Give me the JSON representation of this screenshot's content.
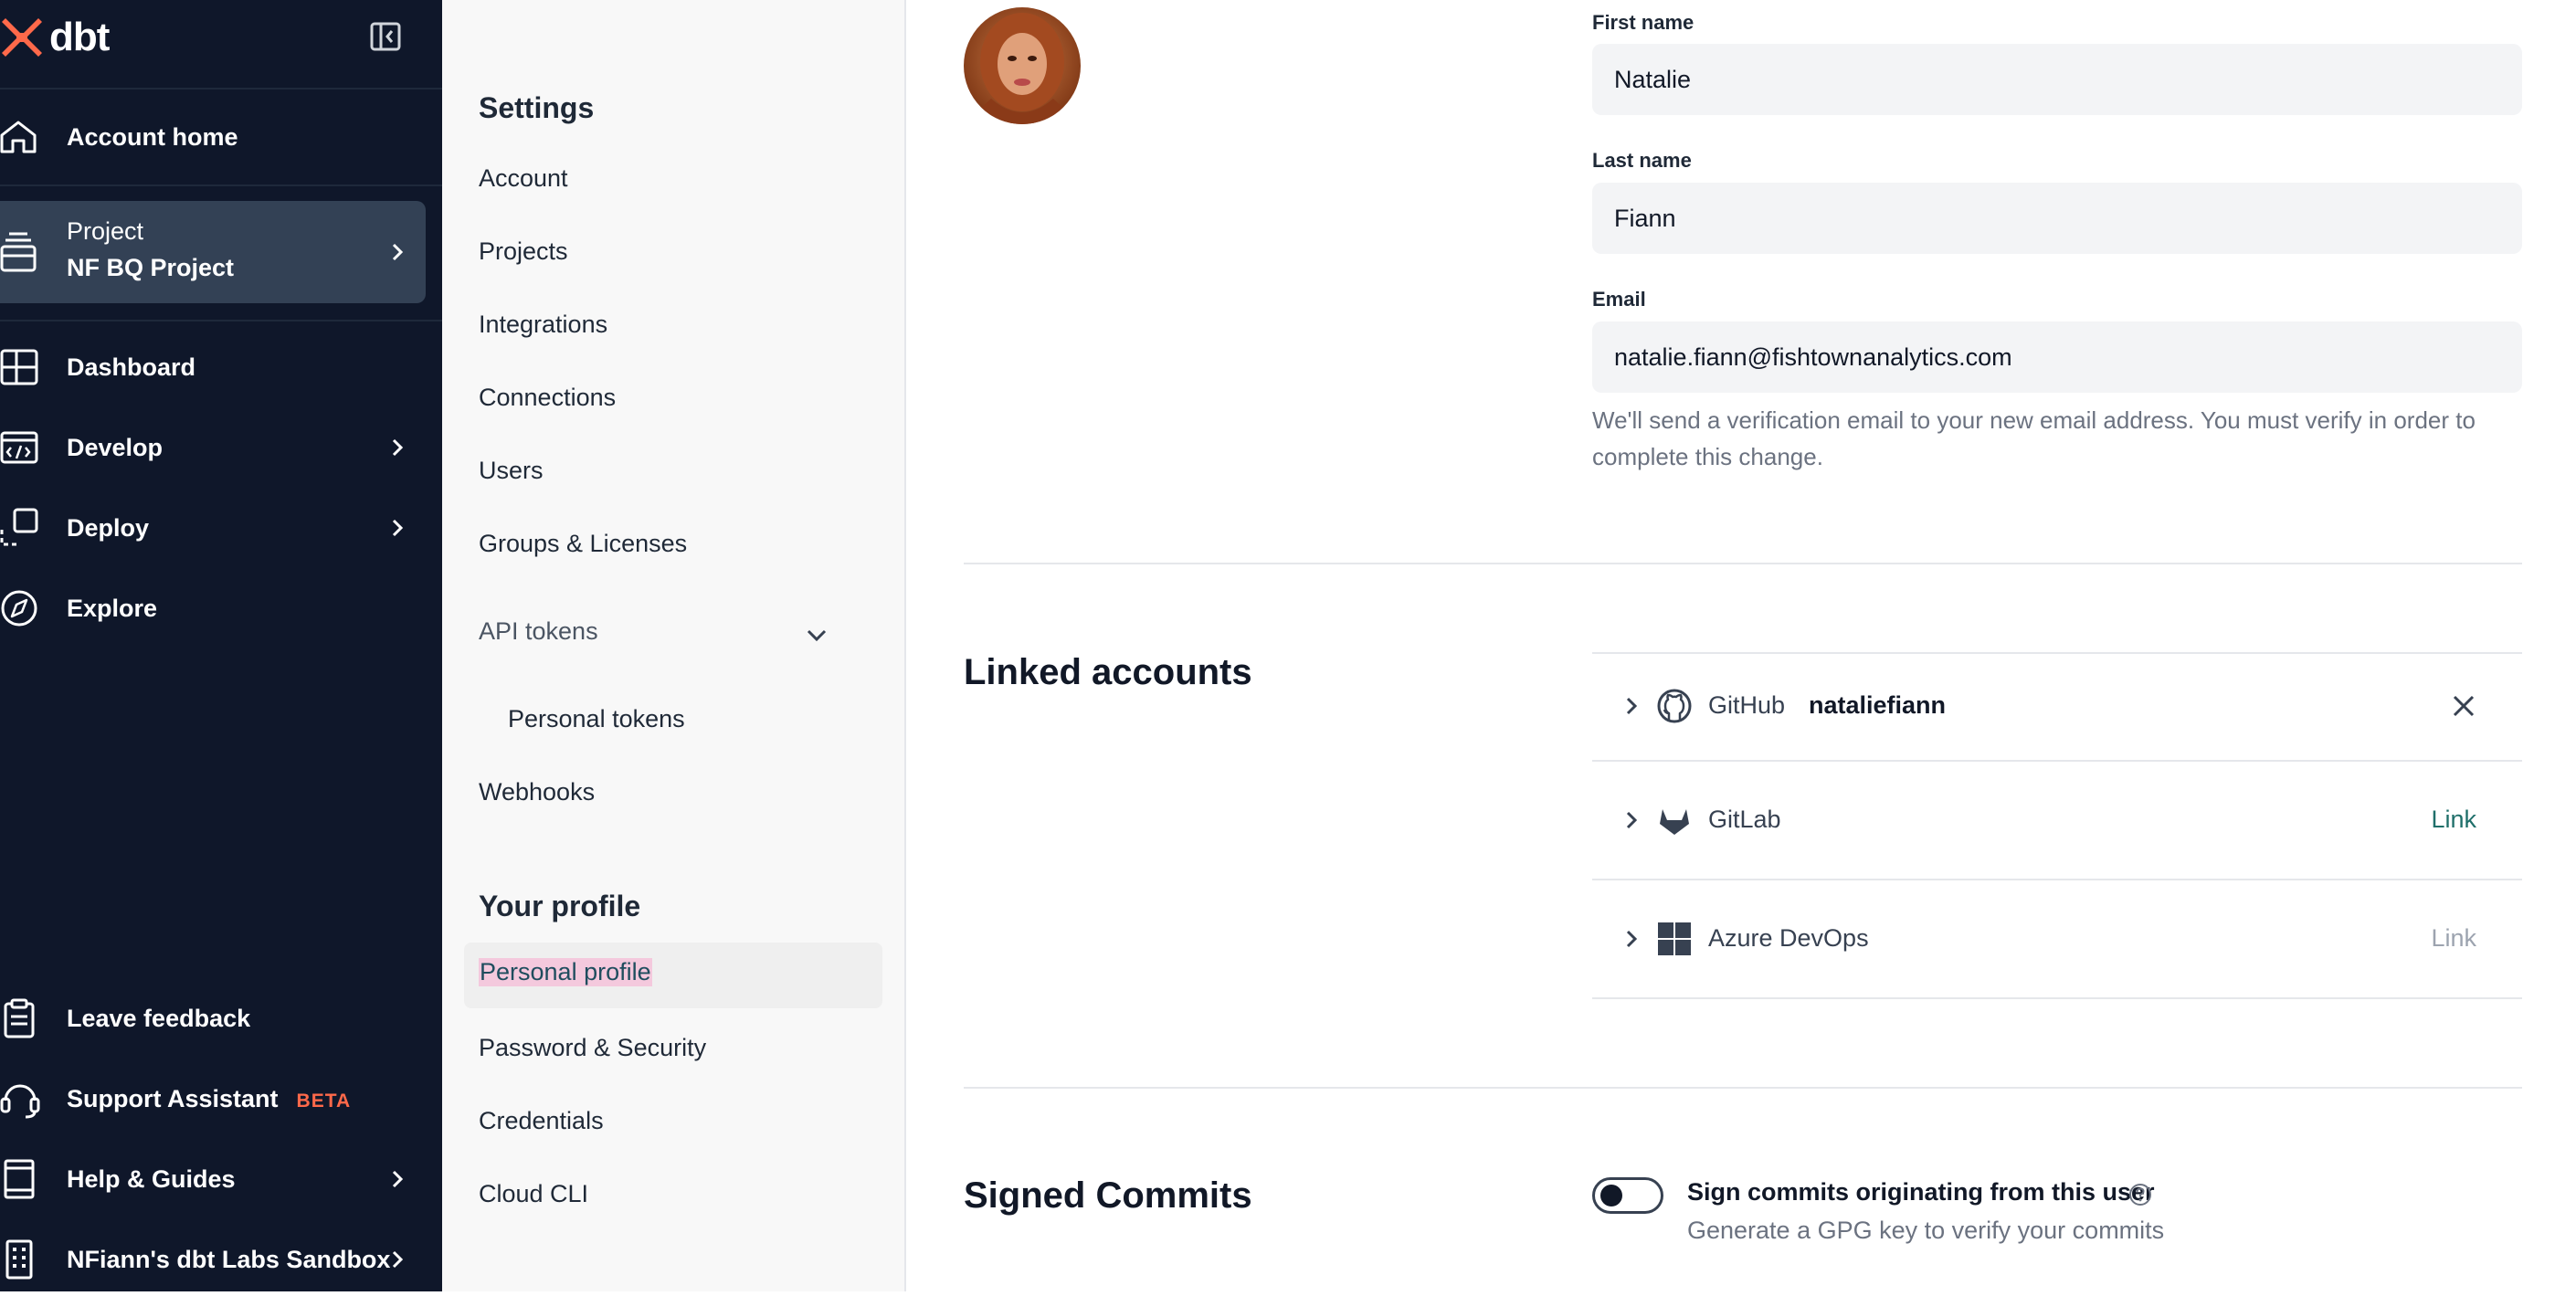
{
  "nav": {
    "logo_text": "dbt",
    "collapse_icon": "sidebar-collapse-icon",
    "items": [
      {
        "id": "account-home",
        "label": "Account home",
        "icon": "home-icon"
      },
      {
        "id": "project",
        "label_top": "Project",
        "label_bottom": "NF BQ Project",
        "icon": "project-icon"
      },
      {
        "id": "dashboard",
        "label": "Dashboard",
        "icon": "dashboard-icon"
      },
      {
        "id": "develop",
        "label": "Develop",
        "icon": "code-icon"
      },
      {
        "id": "deploy",
        "label": "Deploy",
        "icon": "deploy-icon"
      },
      {
        "id": "explore",
        "label": "Explore",
        "icon": "compass-icon"
      },
      {
        "id": "leave-feedback",
        "label": "Leave feedback",
        "icon": "clipboard-icon"
      },
      {
        "id": "support-assistant",
        "label": "Support Assistant",
        "badge": "BETA",
        "icon": "headset-icon"
      },
      {
        "id": "help-guides",
        "label": "Help & Guides",
        "icon": "book-icon"
      },
      {
        "id": "account-switcher",
        "label": "NFiann's dbt Labs Sandbox",
        "icon": "building-icon"
      }
    ]
  },
  "settings": {
    "heading": "Settings",
    "items": [
      "Account",
      "Projects",
      "Integrations",
      "Connections",
      "Users",
      "Groups & Licenses"
    ],
    "api_tokens": "API tokens",
    "personal_tokens": "Personal tokens",
    "webhooks": "Webhooks",
    "profile_heading": "Your profile",
    "profile_items": [
      "Personal profile",
      "Password & Security",
      "Credentials",
      "Cloud CLI"
    ]
  },
  "profile": {
    "first_name_label": "First name",
    "first_name": "Natalie",
    "last_name_label": "Last name",
    "last_name": "Fiann",
    "email_label": "Email",
    "email": "natalie.fiann@fishtownanalytics.com",
    "email_help": "We'll send a verification email to your new email address. You must verify in order to complete this change."
  },
  "linked_accounts": {
    "title": "Linked accounts",
    "rows": [
      {
        "provider": "GitHub",
        "username": "nataliefiann",
        "icon": "github-icon",
        "action": "unlink"
      },
      {
        "provider": "GitLab",
        "username": "",
        "icon": "gitlab-icon",
        "action": "Link"
      },
      {
        "provider": "Azure DevOps",
        "username": "",
        "icon": "azure-devops-icon",
        "action": "Link"
      }
    ]
  },
  "signed_commits": {
    "title": "Signed Commits",
    "toggle_label": "Sign commits originating from this user",
    "toggle_on": false,
    "sub": "Generate a GPG key to verify your commits"
  },
  "colors": {
    "nav_bg": "#0f172a",
    "accent": "#ff694a",
    "link_active": "#1f6f6a",
    "link_disabled": "#9ca3af"
  }
}
